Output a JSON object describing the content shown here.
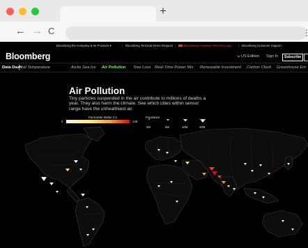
{
  "browser": {
    "traffic_lights": [
      "#ff5f57",
      "#febc2e",
      "#28c840"
    ],
    "new_tab": "+",
    "back_icon": "←",
    "forward_icon": "→",
    "reload_icon": "C",
    "menu_icon": "⋮"
  },
  "top_strip": {
    "company_link": "Bloomberg the Company & Its Products ▾",
    "terminal_link": "Bloomberg Terminal Demo Request",
    "remote_login_link": "Bloomberg Anywhere Remote Login",
    "customer_support_link": "Bloomberg Customer Support",
    "remote_login_color": "#e0413a"
  },
  "header": {
    "logo": "Bloomberg",
    "edition": "US Edition",
    "sign_in": "Sign In",
    "subscribe": "Subscribe"
  },
  "data_dash": {
    "label": "Data Dash",
    "items": [
      {
        "label": "bal Temperature"
      },
      {
        "label": "Arctic Sea Ice"
      },
      {
        "label": "Air Pollution",
        "active": true
      },
      {
        "label": "Tree Loss"
      },
      {
        "label": "Real-Time Power Mix"
      },
      {
        "label": "Renewable Investment"
      },
      {
        "label": "Carbon Clock"
      },
      {
        "label": "Greenhouse Em"
      }
    ],
    "active_color": "#7cfb5a"
  },
  "article": {
    "title": "Air Pollution",
    "description": "Tiny particles suspended in the air contribute to millions of deaths a year. They also harm the climate. See which cities within sensor range have the unhealthiest air."
  },
  "legend": {
    "pm_label": "Particulate Matter 2.5",
    "pm_min": "0",
    "pm_max": "138",
    "population_label": "Population",
    "population_values": [
      "2M",
      "5M",
      "10M",
      "30M"
    ]
  },
  "map": {
    "land_color": "#0d0d0d",
    "border_color": "#3a3a3a",
    "low_color": "#f4f4f4",
    "mid_color": "#ffe07a",
    "high_color": "#d21010"
  }
}
